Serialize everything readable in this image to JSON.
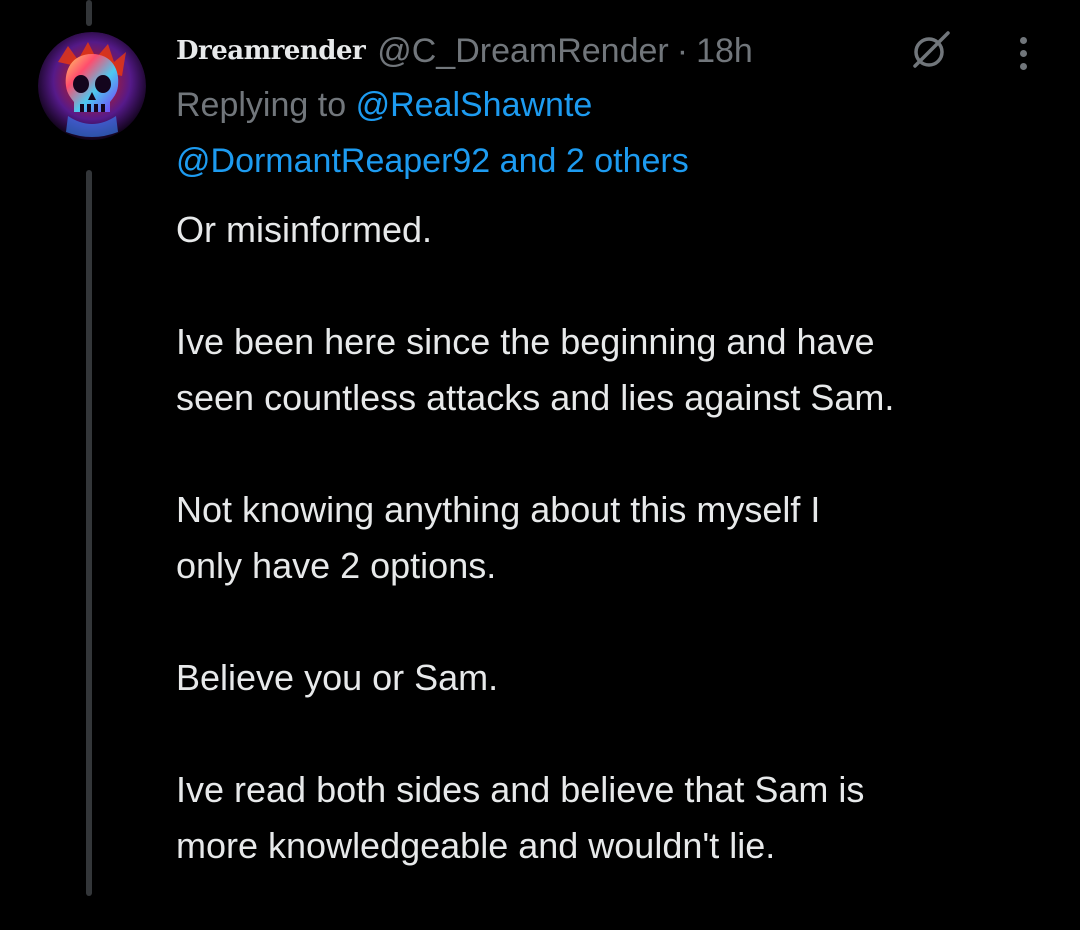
{
  "post": {
    "display_name": "Dreamrender",
    "handle": "@C_DreamRender",
    "separator": "·",
    "time": "18h",
    "avatar_icon": "skull-avatar-icon",
    "reply": {
      "prefix": "Replying to",
      "mention1": "@RealShawnte",
      "mention2": "@DormantReaper92",
      "and_text": "and",
      "others": "2 others"
    },
    "paragraphs": [
      [
        "Or misinformed."
      ],
      [
        "Ive been here since the beginning and have",
        "seen countless attacks and lies against Sam."
      ],
      [
        "Not knowing anything about this myself I",
        "only have 2 options."
      ],
      [
        "Believe you or Sam."
      ],
      [
        "Ive read both sides and believe that Sam is",
        "more knowledgeable and wouldn't lie."
      ]
    ]
  },
  "icons": {
    "grok": "grok-icon",
    "more": "more-options-icon"
  },
  "colors": {
    "background": "#000000",
    "text": "#e7e9ea",
    "secondary": "#71767b",
    "link": "#1d9bf0",
    "thread_line": "#333639"
  }
}
